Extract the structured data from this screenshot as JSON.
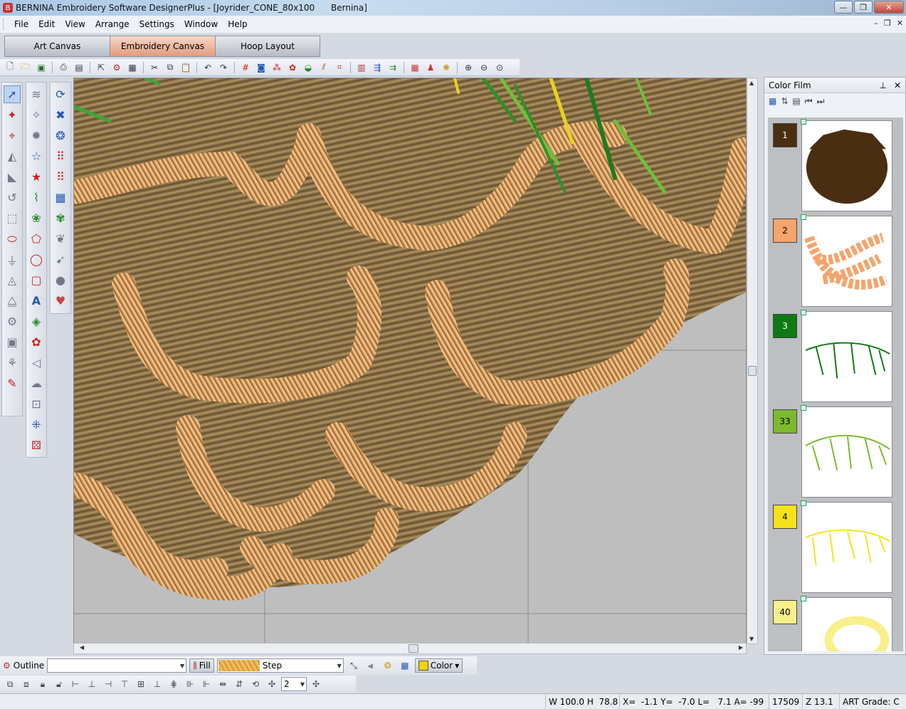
{
  "window": {
    "title": "BERNINA Embroidery Software DesignerPlus - [Joyrider_CONE_80x100      Bernina]",
    "controls": [
      "minimize",
      "restore",
      "close"
    ]
  },
  "menu": {
    "items": [
      "File",
      "Edit",
      "View",
      "Arrange",
      "Settings",
      "Window",
      "Help"
    ]
  },
  "canvas_tabs": [
    {
      "label": "Art Canvas",
      "active": false
    },
    {
      "label": "Embroidery Canvas",
      "active": true
    },
    {
      "label": "Hoop Layout",
      "active": false
    }
  ],
  "color_film": {
    "title": "Color Film",
    "pin_icon": "pin-icon",
    "close_icon": "close-icon",
    "items": [
      {
        "number": "1",
        "color": "#4a2e12",
        "text_color": "#ffffff"
      },
      {
        "number": "2",
        "color": "#f5a46b",
        "text_color": "#000000"
      },
      {
        "number": "3",
        "color": "#0f7a14",
        "text_color": "#ffffff"
      },
      {
        "number": "33",
        "color": "#7db92e",
        "text_color": "#000000"
      },
      {
        "number": "4",
        "color": "#f5e21a",
        "text_color": "#000000"
      },
      {
        "number": "40",
        "color": "#f8f08a",
        "text_color": "#000000"
      }
    ]
  },
  "property_bar": {
    "outline_label": "Outline",
    "outline_value": "",
    "fill_label": "Fill",
    "fill_type": "Step",
    "color_label": "Color",
    "color_value": "#f2d200"
  },
  "arrange_bar": {
    "count_value": "2"
  },
  "status": {
    "size": "W 100.0 H  78.8",
    "coords": "X=  -1.1 Y=  -7.0 L=   7.1 A= -99",
    "stitches": "17509",
    "zoom": "Z 13.1",
    "art_grade": "ART Grade: C"
  }
}
